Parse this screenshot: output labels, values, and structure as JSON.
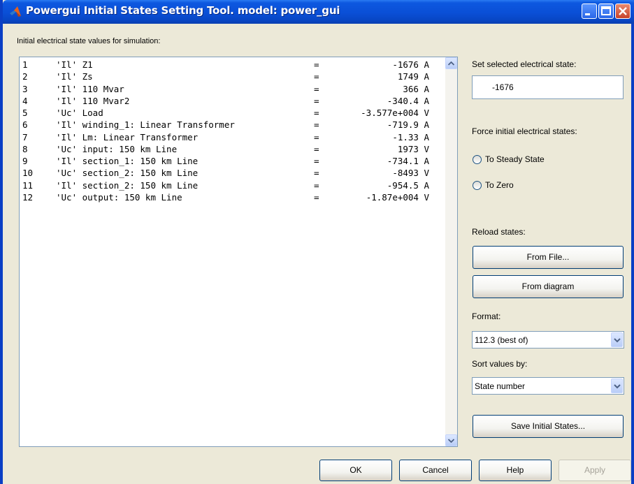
{
  "window": {
    "title": "Powergui Initial States Setting Tool.  model: power_gui"
  },
  "list": {
    "header": "Initial electrical state values for simulation:",
    "rows": [
      {
        "num": "1",
        "name": "'Il' Z1",
        "eq": "=",
        "value": "-1676 A"
      },
      {
        "num": "2",
        "name": "'Il' Zs",
        "eq": "=",
        "value": "1749 A"
      },
      {
        "num": "3",
        "name": "'Il' 110 Mvar",
        "eq": "=",
        "value": "366 A"
      },
      {
        "num": "4",
        "name": "'Il' 110 Mvar2",
        "eq": "=",
        "value": "-340.4 A"
      },
      {
        "num": "5",
        "name": "'Uc' Load",
        "eq": "=",
        "value": "-3.577e+004 V"
      },
      {
        "num": "6",
        "name": "'Il' winding_1: Linear Transformer",
        "eq": "=",
        "value": "-719.9 A"
      },
      {
        "num": "7",
        "name": "'Il' Lm: Linear Transformer",
        "eq": "=",
        "value": "-1.33 A"
      },
      {
        "num": "8",
        "name": "'Uc' input: 150 km Line",
        "eq": "=",
        "value": "1973 V"
      },
      {
        "num": "9",
        "name": "'Il' section_1: 150 km Line",
        "eq": "=",
        "value": "-734.1 A"
      },
      {
        "num": "10",
        "name": "'Uc' section_2: 150 km Line",
        "eq": "=",
        "value": "-8493 V"
      },
      {
        "num": "11",
        "name": "'Il' section_2: 150 km Line",
        "eq": "=",
        "value": "-954.5 A"
      },
      {
        "num": "12",
        "name": "'Uc' output: 150 km Line",
        "eq": "=",
        "value": "-1.87e+004 V"
      }
    ]
  },
  "side": {
    "set_label": "Set selected electrical state:",
    "set_value": "-1676",
    "force_label": "Force initial electrical states:",
    "radio_steady": "To Steady State",
    "radio_zero": "To Zero",
    "reload_label": "Reload states:",
    "from_file": "From File...",
    "from_diagram": "From diagram",
    "format_label": "Format:",
    "format_value": "112.3 (best of)",
    "sort_label": "Sort values by:",
    "sort_value": "State number",
    "save_button": "Save Initial States..."
  },
  "footer": {
    "ok": "OK",
    "cancel": "Cancel",
    "help": "Help",
    "apply": "Apply"
  },
  "icons": {
    "app": "matlab-logo-icon",
    "minimize": "minimize-icon",
    "maximize": "maximize-icon",
    "close": "close-icon",
    "scroll_up": "scroll-up-arrow-icon",
    "scroll_down": "scroll-down-arrow-icon",
    "dropdown": "chevron-down-icon"
  },
  "colors": {
    "titlebar": "#0a4fd6",
    "dialog_bg": "#ece9d8",
    "close_button": "#c7432b"
  }
}
